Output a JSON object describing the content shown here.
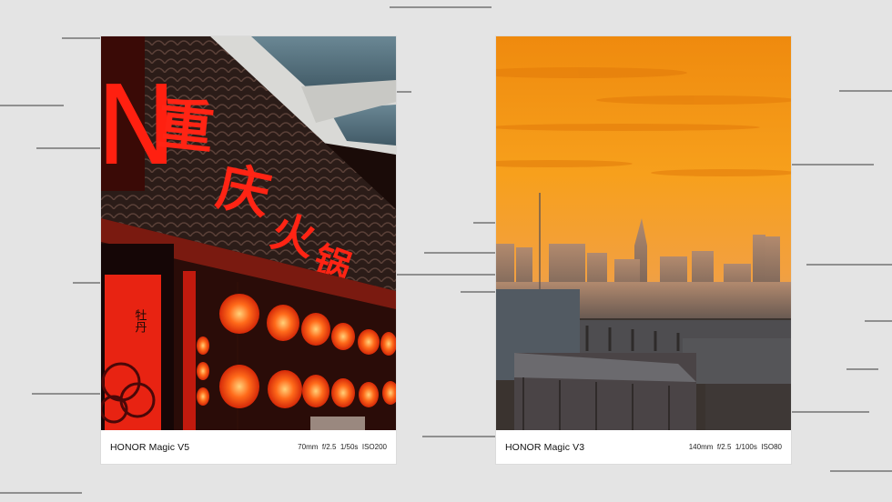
{
  "photos": [
    {
      "device": "HONOR Magic V5",
      "exif": "70mm  f/2.5  1/50s  ISO200",
      "sign_text": "重庆火锅",
      "sign_partial": "N",
      "banner_text": "牡丹",
      "accent": "#ff2a10"
    },
    {
      "device": "HONOR Magic V3",
      "exif": "140mm  f/2.5  1/100s  ISO80",
      "sky_colors": [
        "#f08a0c",
        "#f7a21a",
        "#c98c56"
      ]
    }
  ]
}
